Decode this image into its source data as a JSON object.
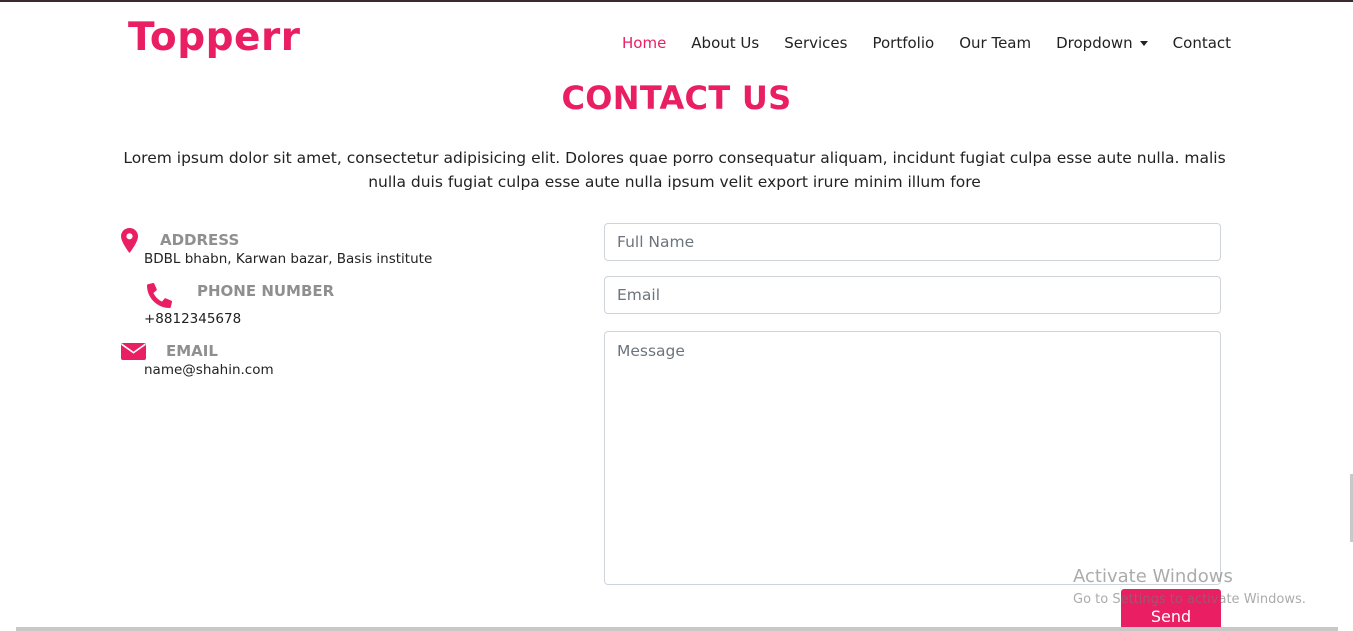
{
  "brand": {
    "logo": "Topperr",
    "accent_color": "#e91e63"
  },
  "nav": {
    "items": [
      {
        "label": "Home",
        "active": true
      },
      {
        "label": "About Us"
      },
      {
        "label": "Services"
      },
      {
        "label": "Portfolio"
      },
      {
        "label": "Our Team"
      },
      {
        "label": "Dropdown",
        "has_caret": true
      },
      {
        "label": "Contact"
      }
    ]
  },
  "contact": {
    "title": "CONTACT US",
    "intro": "Lorem ipsum dolor sit amet, consectetur adipisicing elit. Dolores quae porro consequatur aliquam, incidunt fugiat culpa esse aute nulla. malis nulla duis fugiat culpa esse aute nulla ipsum velit export irure minim illum fore",
    "info": {
      "address": {
        "icon": "map-marker-icon",
        "label": "ADDRESS",
        "value": "BDBL bhabn, Karwan bazar, Basis institute"
      },
      "phone": {
        "icon": "phone-icon",
        "label": "PHONE NUMBER",
        "value": "+8812345678"
      },
      "email": {
        "icon": "envelope-icon",
        "label": "EMAIL",
        "value": "name@shahin.com"
      }
    },
    "form": {
      "name_placeholder": "Full Name",
      "email_placeholder": "Email",
      "message_placeholder": "Message",
      "send_label": "Send"
    }
  },
  "os_watermark": {
    "title": "Activate Windows",
    "subtitle": "Go to Settings to activate Windows."
  }
}
